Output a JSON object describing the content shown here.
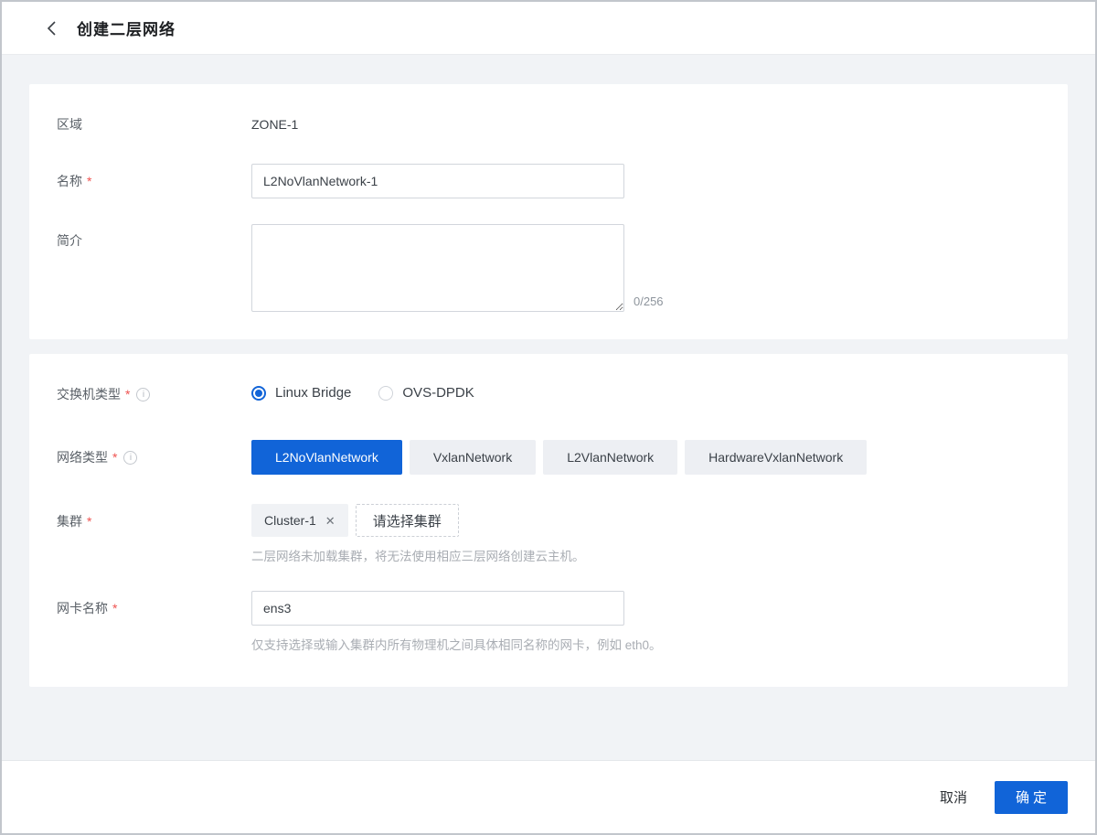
{
  "header": {
    "title": "创建二层网络"
  },
  "colors": {
    "primary": "#1164d8",
    "page_bg": "#f1f3f6",
    "required": "#ef5350"
  },
  "form": {
    "zone": {
      "label": "区域",
      "value": "ZONE-1"
    },
    "name": {
      "label": "名称",
      "required": "*",
      "value": "L2NoVlanNetwork-1"
    },
    "description": {
      "label": "简介",
      "value": "",
      "counter": "0/256"
    },
    "switch_type": {
      "label": "交换机类型",
      "required": "*",
      "options": [
        "Linux Bridge",
        "OVS-DPDK"
      ],
      "selected": "Linux Bridge"
    },
    "network_type": {
      "label": "网络类型",
      "required": "*",
      "options": [
        "L2NoVlanNetwork",
        "VxlanNetwork",
        "L2VlanNetwork",
        "HardwareVxlanNetwork"
      ],
      "selected": "L2NoVlanNetwork"
    },
    "cluster": {
      "label": "集群",
      "required": "*",
      "tag": "Cluster-1",
      "tag_close": "✕",
      "select_button": "请选择集群",
      "hint": "二层网络未加载集群，将无法使用相应三层网络创建云主机。"
    },
    "nic": {
      "label": "网卡名称",
      "required": "*",
      "value": "ens3",
      "hint": "仅支持选择或输入集群内所有物理机之间具体相同名称的网卡，例如 eth0。"
    }
  },
  "footer": {
    "cancel": "取消",
    "confirm": "确定"
  }
}
